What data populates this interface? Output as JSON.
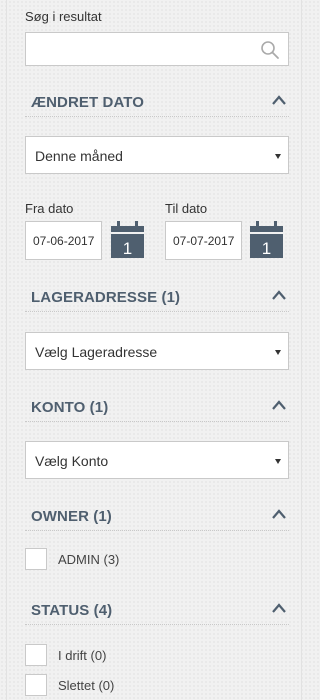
{
  "search": {
    "label": "Søg i resultat",
    "value": "",
    "placeholder": ""
  },
  "sections": {
    "date": {
      "title": "ÆNDRET DATO",
      "select_value": "Denne måned",
      "from_label": "Fra dato",
      "from_value": "07-06-2017",
      "to_label": "Til dato",
      "to_value": "07-07-2017",
      "calendar_day": "1"
    },
    "storage": {
      "title": "LAGERADRESSE (1)",
      "select_value": "Vælg Lageradresse"
    },
    "account": {
      "title": "KONTO (1)",
      "select_value": "Vælg Konto"
    },
    "owner": {
      "title": "OWNER (1)",
      "options": [
        {
          "label": "ADMIN (3)",
          "checked": false
        }
      ]
    },
    "status": {
      "title": "STATUS (4)",
      "options": [
        {
          "label": "I drift (0)",
          "checked": false
        },
        {
          "label": "Slettet (0)",
          "checked": false
        }
      ]
    }
  },
  "colors": {
    "heading": "#4f5f6f",
    "calendar": "#4f5f6f",
    "border": "#c9c9c9"
  },
  "icons": {
    "search": "search-icon",
    "collapse": "chevron-up-icon",
    "calendar": "calendar-icon",
    "dropdown": "caret-down-icon"
  }
}
